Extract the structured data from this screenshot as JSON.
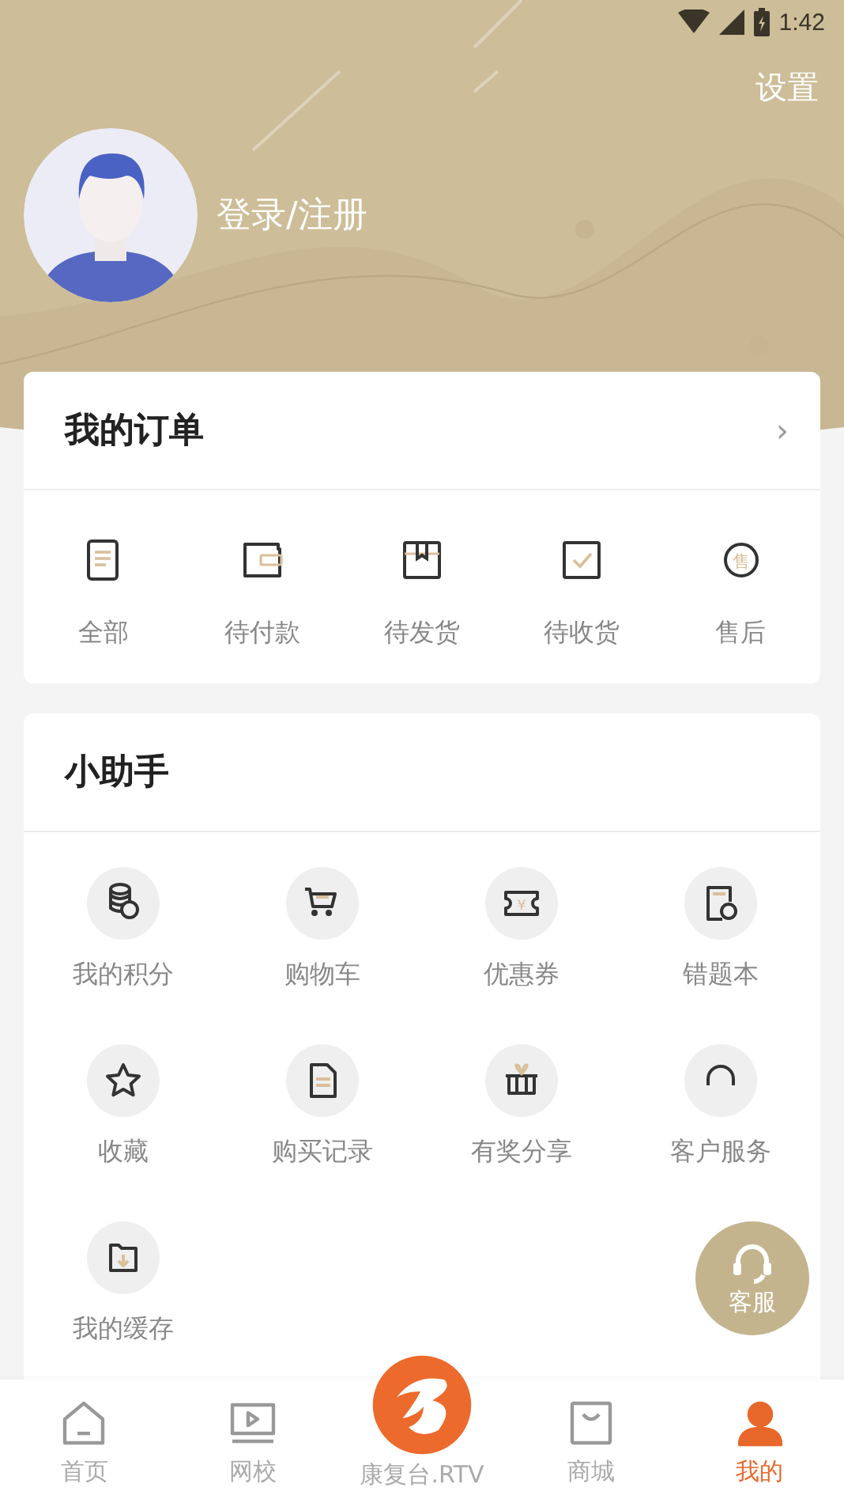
{
  "status_bar": {
    "time": "1:42"
  },
  "header": {
    "settings": "设置",
    "login": "登录/注册"
  },
  "orders": {
    "title": "我的订单",
    "arrow": "›",
    "items": [
      {
        "label": "全部"
      },
      {
        "label": "待付款"
      },
      {
        "label": "待发货"
      },
      {
        "label": "待收货"
      },
      {
        "label": "售后",
        "glyph": "售"
      }
    ]
  },
  "assistant": {
    "title": "小助手",
    "items": [
      {
        "label": "我的积分"
      },
      {
        "label": "购物车"
      },
      {
        "label": "优惠券",
        "glyph": "¥"
      },
      {
        "label": "错题本"
      },
      {
        "label": "收藏"
      },
      {
        "label": "购买记录"
      },
      {
        "label": "有奖分享"
      },
      {
        "label": "客户服务"
      },
      {
        "label": "我的缓存"
      }
    ]
  },
  "float_button": {
    "label": "客服"
  },
  "nav": [
    {
      "label": "首页",
      "selected": false
    },
    {
      "label": "网校",
      "selected": false
    },
    {
      "label": "康复台.RTV",
      "selected": false
    },
    {
      "label": "商城",
      "selected": false
    },
    {
      "label": "我的",
      "selected": true
    }
  ]
}
